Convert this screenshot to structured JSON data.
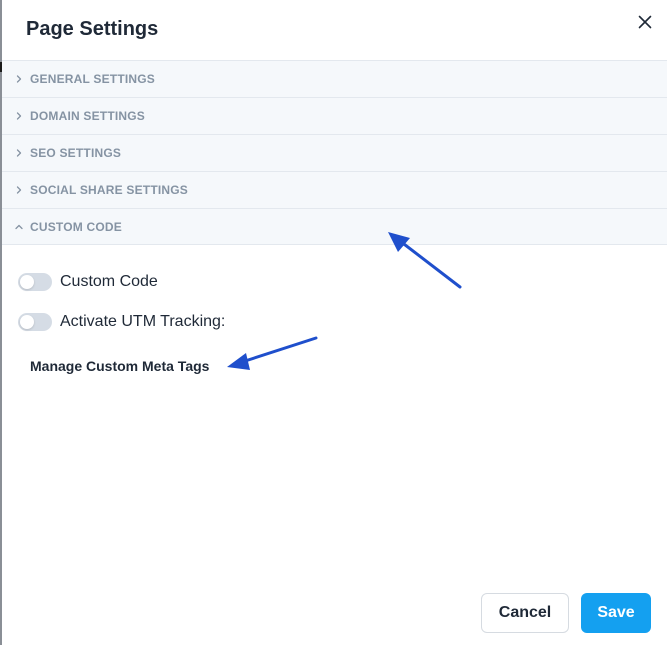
{
  "dialog": {
    "title": "Page Settings",
    "close_icon": "close-icon"
  },
  "accordion": {
    "sections": [
      {
        "label": "GENERAL SETTINGS",
        "expanded": false
      },
      {
        "label": "DOMAIN SETTINGS",
        "expanded": false
      },
      {
        "label": "SEO SETTINGS",
        "expanded": false
      },
      {
        "label": "SOCIAL SHARE SETTINGS",
        "expanded": false
      },
      {
        "label": "CUSTOM CODE",
        "expanded": true
      }
    ]
  },
  "custom_code": {
    "toggles": [
      {
        "label": "Custom Code",
        "on": false
      },
      {
        "label": "Activate UTM Tracking:",
        "on": false
      }
    ],
    "meta_tags_link": "Manage Custom Meta Tags"
  },
  "footer": {
    "cancel_label": "Cancel",
    "save_label": "Save"
  },
  "colors": {
    "accent": "#14a0f0",
    "section_bg": "#f5f8fb",
    "section_text": "#8593a3",
    "annotation_arrow": "#1f4fcc"
  }
}
